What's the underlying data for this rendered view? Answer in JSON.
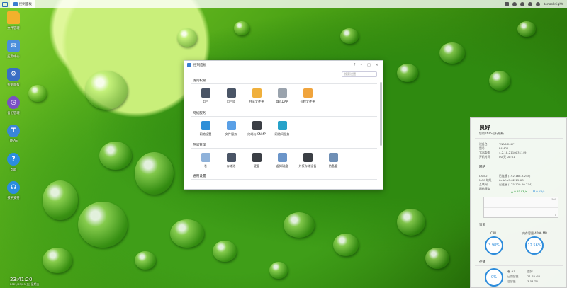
{
  "topbar": {
    "task_label": "控制面板",
    "username": "tonosknight"
  },
  "desktop": {
    "items": [
      {
        "label": "文件管理",
        "icon": "folder-icon",
        "color": "#f2b12c",
        "glyph": ""
      },
      {
        "label": "应用中心",
        "icon": "mail-icon",
        "color": "#4b8fdc",
        "glyph": "✉"
      },
      {
        "label": "控制面板",
        "icon": "gear-icon",
        "color": "#3a6fc4",
        "glyph": "⚙"
      },
      {
        "label": "备份管理",
        "icon": "clock-icon",
        "color": "#7a4fc4",
        "glyph": "◷"
      },
      {
        "label": "TNAS",
        "icon": "tnas-icon",
        "color": "#3a86d8",
        "glyph": "T"
      },
      {
        "label": "帮助",
        "icon": "help-icon",
        "color": "#2b8de0",
        "glyph": "?"
      },
      {
        "label": "技术支持",
        "icon": "headset-icon",
        "color": "#2b8de0",
        "glyph": "☊"
      }
    ],
    "clock_time": "23:41:20",
    "clock_date": "2021/03/05(五) 星期五"
  },
  "window": {
    "title": "控制面板",
    "search_placeholder": "搜索设置",
    "sections": [
      {
        "title": "访问权限",
        "items": [
          {
            "label": "用户",
            "color": "#4a5566"
          },
          {
            "label": "用户组",
            "color": "#4a5566"
          },
          {
            "label": "共享文件夹",
            "color": "#f0b03c"
          },
          {
            "label": "域/LDAP",
            "color": "#9aa3ad"
          },
          {
            "label": "远程文件夹",
            "color": "#f0a43c"
          }
        ]
      },
      {
        "title": "网络服务",
        "items": [
          {
            "label": "网络设置",
            "color": "#2f8fd8"
          },
          {
            "label": "文件服务",
            "color": "#5aa0e6"
          },
          {
            "label": "终端与 SNMP",
            "color": "#3b3f45"
          },
          {
            "label": "网络间服务",
            "color": "#27a2c9"
          }
        ]
      },
      {
        "title": "存储管理",
        "items": [
          {
            "label": "卷",
            "color": "#8fb2da"
          },
          {
            "label": "存储池",
            "color": "#4a5566"
          },
          {
            "label": "硬盘",
            "color": "#3b3f45"
          },
          {
            "label": "虚拟磁盘",
            "color": "#6b95c9"
          },
          {
            "label": "外接存储设备",
            "color": "#3b3f45"
          },
          {
            "label": "热备盘",
            "color": "#6f8fb5"
          }
        ]
      },
      {
        "title": "通用设置",
        "items": []
      }
    ]
  },
  "monitor": {
    "status": "良好",
    "subtitle": "您的TNAS运行顺畅",
    "info": [
      {
        "key": "设备名",
        "value": "TNAS-240F"
      },
      {
        "key": "型号",
        "value": "F4-421"
      },
      {
        "key": "TOS版本",
        "value": "4.2.18-2110031149"
      },
      {
        "key": "开机时间",
        "value": "00 天 00:01"
      }
    ],
    "network_title": "网络",
    "network": [
      {
        "key": "LAN 2",
        "value": "已连接 (192.168.3.248)"
      },
      {
        "key": "MAC 地址",
        "value": "6c:bf:b5:02:25:03"
      },
      {
        "key": "互联网",
        "value": "已连接 (125.120.60.274)"
      },
      {
        "key": "网络速度",
        "value": ""
      }
    ],
    "upload": "0.93 KB/s",
    "download": "0 KB/s",
    "graph_top": "500",
    "graph_bottom": "0",
    "resource_title": "资源",
    "cpu_label": "CPU",
    "cpu_value": "3.98%",
    "cpu_fraction": 0.0398,
    "mem_label": "内存容量 4096 MB",
    "mem_value": "12.56%",
    "mem_fraction": 0.1256,
    "storage_title": "存储",
    "storage_gauge": "0%",
    "storage_rows": [
      {
        "key": "卷 #1",
        "value": "良好"
      },
      {
        "key": "已用容量",
        "value": "21.62 GB"
      },
      {
        "key": "总容量",
        "value": "3.54 TB"
      }
    ]
  }
}
